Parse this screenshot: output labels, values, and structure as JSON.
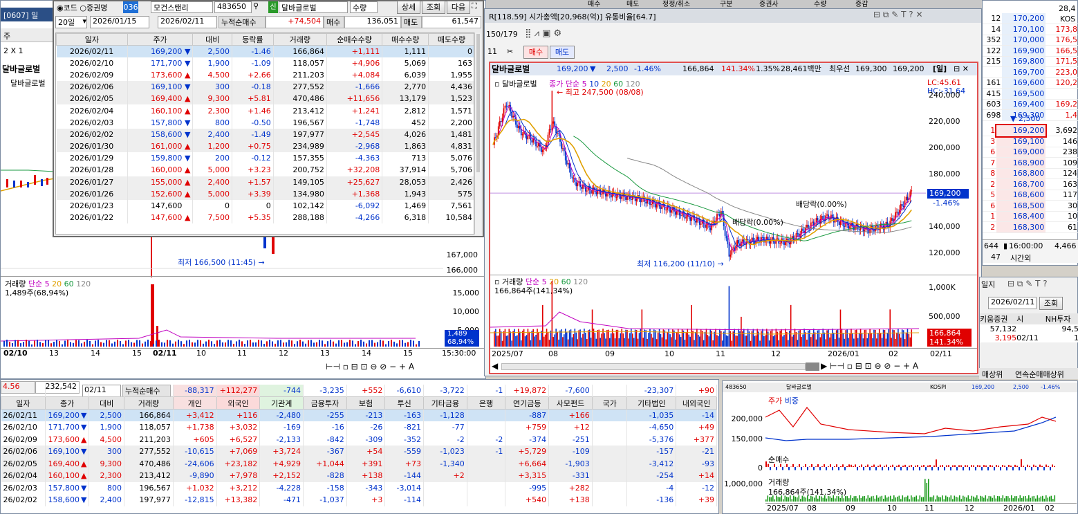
{
  "left_window": {
    "title": "[0607] 일",
    "chart_title": "달바글로벌",
    "chart_sub": "달바글로벌",
    "low_label": "최저 166,500 (11:45)",
    "prices": [
      "167,000",
      "166,000"
    ],
    "vol_legend": {
      "label": "거래량",
      "ma": "단순",
      "p1": "5",
      "p2": "20",
      "p3": "60",
      "p4": "120"
    },
    "vol_value": "1,489주(68,94%)",
    "vol_axis": [
      "15,000",
      "10,000",
      "5,000"
    ],
    "vol_box1": "1,489",
    "vol_box2": "68,94%",
    "x_labels": [
      "02/10",
      "13",
      "14",
      "15",
      "02/11",
      "10",
      "11",
      "12",
      "13",
      "14",
      "15",
      "15:30:00"
    ],
    "stats_label": "4.56",
    "stats_value": "232,542",
    "tool_row": "2 X 1",
    "zoom": "주"
  },
  "daily_popup": {
    "radio1": "코드",
    "radio2": "증권명",
    "broker_code": "036",
    "broker_name": "모건스탠리",
    "stock_code": "483650",
    "stock_badge": "신",
    "stock_name": "달바글로벌",
    "qty_label": "수량",
    "btn_detail": "상세",
    "btn_query": "조회",
    "btn_next": "다음",
    "period": "20일",
    "date_from": "2026/01/15",
    "date_to": "2026/02/11",
    "cum_label": "누적순매수",
    "cum_value": "+74,504",
    "buy_label": "매수",
    "buy_value": "136,051",
    "sell_label": "매도",
    "sell_value": "61,547",
    "columns": [
      "일자",
      "주가",
      "대비",
      "등락률",
      "거래량",
      "순매수수량",
      "매수수량",
      "매도수량"
    ],
    "rows": [
      [
        "2026/02/11",
        "169,200",
        "▼",
        "2,500",
        "-1.46",
        "166,864",
        "+1,111",
        "1,111",
        "0"
      ],
      [
        "2026/02/10",
        "171,700",
        "▼",
        "1,900",
        "-1.09",
        "118,057",
        "+4,906",
        "5,069",
        "163"
      ],
      [
        "2026/02/09",
        "173,600",
        "▲",
        "4,500",
        "+2.66",
        "211,203",
        "+4,084",
        "6,039",
        "1,955"
      ],
      [
        "2026/02/06",
        "169,100",
        "▼",
        "300",
        "-0.18",
        "277,552",
        "-1,666",
        "2,770",
        "4,436"
      ],
      [
        "2026/02/05",
        "169,400",
        "▲",
        "9,300",
        "+5.81",
        "470,486",
        "+11,656",
        "13,179",
        "1,523"
      ],
      [
        "2026/02/04",
        "160,100",
        "▲",
        "2,300",
        "+1.46",
        "213,412",
        "+1,241",
        "2,812",
        "1,571"
      ],
      [
        "2026/02/03",
        "157,800",
        "▼",
        "800",
        "-0.50",
        "196,567",
        "-1,748",
        "452",
        "2,200"
      ],
      [
        "2026/02/02",
        "158,600",
        "▼",
        "2,400",
        "-1.49",
        "197,977",
        "+2,545",
        "4,026",
        "1,481"
      ],
      [
        "2026/01/30",
        "161,000",
        "▲",
        "1,200",
        "+0.75",
        "234,989",
        "-2,968",
        "1,863",
        "4,831"
      ],
      [
        "2026/01/29",
        "159,800",
        "▼",
        "200",
        "-0.12",
        "157,355",
        "-4,363",
        "713",
        "5,076"
      ],
      [
        "2026/01/28",
        "160,000",
        "▲",
        "5,000",
        "+3.23",
        "200,752",
        "+32,208",
        "37,914",
        "5,706"
      ],
      [
        "2026/01/27",
        "155,000",
        "▲",
        "2,400",
        "+1.57",
        "149,105",
        "+25,627",
        "28,053",
        "2,426"
      ],
      [
        "2026/01/26",
        "152,600",
        "▲",
        "5,000",
        "+3.39",
        "134,980",
        "+1,368",
        "1,943",
        "575"
      ],
      [
        "2026/01/23",
        "147,600",
        "",
        "0",
        "0",
        "102,142",
        "-6,092",
        "1,469",
        "7,561"
      ],
      [
        "2026/01/22",
        "147,600",
        "▲",
        "7,500",
        "+5.35",
        "288,188",
        "-4,266",
        "6,318",
        "10,584"
      ]
    ]
  },
  "main_chart": {
    "title_bar": "R[118.59] 시가총액[20,968(억)] 유통비율[64.7]",
    "page": "150/179",
    "buy_btn": "매수",
    "sell_btn": "매도",
    "info": {
      "name": "달바글로벌",
      "price": "169,200",
      "arrow": "▼",
      "change": "2,500",
      "rate": "-1.46%",
      "volume": "166,864",
      "vol_ratio": "141.34%",
      "turnover": "1.35%",
      "amount": "28,461백만",
      "best_ask_label": "최우선",
      "best_ask": "169,300",
      "best_bid": "169,200",
      "period": "일"
    },
    "legend": {
      "name": "달바글로벌",
      "close": "종가",
      "ma": "단순",
      "p1": "5",
      "p2": "10",
      "p3": "20",
      "p4": "60",
      "p5": "120"
    },
    "lc": "LC:45.61",
    "hc": "HC:-31.64",
    "high_label": "최고 247,500 (08/08)",
    "low_label": "최저 116,200 (11/10)",
    "div1": "배당락(0.00%)",
    "div2": "배당락(0.00%)",
    "y_axis": [
      "240,000",
      "220,000",
      "200,000",
      "180,000",
      "160,000",
      "140,000",
      "120,000"
    ],
    "price_box": "169,200",
    "price_rate": "-1.46%",
    "vol_legend": {
      "label": "거래량",
      "ma": "단순",
      "p1": "5",
      "p2": "20",
      "p3": "60",
      "p4": "120"
    },
    "vol_value": "166,864주(141,34%)",
    "vol_axis": [
      "1,000K",
      "500,000"
    ],
    "vol_box1": "166,864",
    "vol_box2": "141.34%",
    "x_labels": [
      "2025/07",
      "08",
      "09",
      "10",
      "11",
      "12",
      "2026/01",
      "02",
      "02/11"
    ]
  },
  "top_right_tabs": [
    "구분",
    "증권사",
    "수량",
    "증감"
  ],
  "top_tabs": [
    "매수",
    "매도",
    "정정/취소"
  ],
  "orderbook": {
    "rows": [
      [
        "12",
        "170,200",
        ""
      ],
      [
        "14",
        "170,100",
        "173,8"
      ],
      [
        "352",
        "170,000",
        "176,5"
      ],
      [
        "122",
        "169,900",
        "166,5"
      ],
      [
        "215",
        "169,800",
        "171,5"
      ],
      [
        "",
        "169,700",
        "223,0"
      ],
      [
        "161",
        "169,600",
        "120,2"
      ],
      [
        "415",
        "169,500",
        ""
      ],
      [
        "603",
        "169,400",
        "169,2"
      ],
      [
        "698",
        "169,300",
        "1,4"
      ]
    ],
    "ask_label": "▼ 2,500",
    "kosdaq": "KOS",
    "bids": [
      [
        "1",
        "169,200",
        "3,692"
      ],
      [
        "3",
        "169,100",
        "146"
      ],
      [
        "6",
        "169,000",
        "238"
      ],
      [
        "7",
        "168,900",
        "109"
      ],
      [
        "8",
        "168,800",
        "124"
      ],
      [
        "2",
        "168,700",
        "163"
      ],
      [
        "5",
        "168,600",
        "117"
      ],
      [
        "6",
        "168,500",
        "30"
      ],
      [
        "1",
        "168,400",
        "10"
      ],
      [
        "2",
        "168,300",
        "61"
      ]
    ],
    "total_left": "644",
    "time": "16:00:00",
    "total_right": "4,466",
    "after": "47",
    "after_label": "시간외",
    "top_value": "28,4"
  },
  "broker_panel": {
    "title": "일지",
    "date": "2026/02/11",
    "btn": "조회",
    "col1": "키움증권",
    "col2": "시",
    "col3": "NH투자",
    "v1": "57,132",
    "v2": "94,5",
    "v3": "3,195",
    "v4": "02/11",
    "v5": "1"
  },
  "right_tabs": [
    "매상위",
    "연속순매매상위"
  ],
  "investor": {
    "date": "02/11",
    "cum_label": "누적순매수",
    "header_left": "4.56",
    "header_val": "232,542",
    "cum_values": [
      "-88,317",
      "+112,277",
      "-744",
      "-3,235",
      "+552",
      "-6,610",
      "-3,722",
      "-1",
      "+19,872",
      "-7,600",
      "",
      "-23,307",
      "+90"
    ],
    "columns": [
      "일자",
      "종가",
      "대비",
      "거래량",
      "개인",
      "외국인",
      "기관계",
      "금융투자",
      "보험",
      "투신",
      "기타금융",
      "은행",
      "연기금등",
      "사모펀드",
      "국가",
      "기타법인",
      "내외국인"
    ],
    "rows": [
      [
        "26/02/11",
        "169,200",
        "▼",
        "2,500",
        "166,864",
        "+3,412",
        "+116",
        "-2,480",
        "-255",
        "-213",
        "-163",
        "-1,128",
        "",
        "-887",
        "+166",
        "",
        "-1,035",
        "-14"
      ],
      [
        "26/02/10",
        "171,700",
        "▼",
        "1,900",
        "118,057",
        "+1,738",
        "+3,032",
        "-169",
        "-16",
        "-26",
        "-821",
        "-77",
        "",
        "+759",
        "+12",
        "",
        "-4,650",
        "+49"
      ],
      [
        "26/02/09",
        "173,600",
        "▲",
        "4,500",
        "211,203",
        "+605",
        "+6,527",
        "-2,133",
        "-842",
        "-309",
        "-352",
        "-2",
        "-2",
        "-374",
        "-251",
        "",
        "-5,376",
        "+377"
      ],
      [
        "26/02/06",
        "169,100",
        "▼",
        "300",
        "277,552",
        "-10,615",
        "+7,069",
        "+3,724",
        "-367",
        "+54",
        "-559",
        "-1,023",
        "-1",
        "+5,729",
        "-109",
        "",
        "-157",
        "-21"
      ],
      [
        "26/02/05",
        "169,400",
        "▲",
        "9,300",
        "470,486",
        "-24,606",
        "+23,182",
        "+4,929",
        "+1,044",
        "+391",
        "+73",
        "-1,340",
        "",
        "+6,664",
        "-1,903",
        "",
        "-3,412",
        "-93"
      ],
      [
        "26/02/04",
        "160,100",
        "▲",
        "2,300",
        "213,412",
        "-9,890",
        "+7,978",
        "+2,152",
        "-828",
        "+138",
        "-144",
        "+2",
        "",
        "+3,315",
        "-331",
        "",
        "-254",
        "+14"
      ],
      [
        "26/02/03",
        "157,800",
        "▼",
        "800",
        "196,567",
        "+1,032",
        "+3,212",
        "-4,228",
        "-158",
        "-343",
        "-3,014",
        "",
        "",
        "-995",
        "+282",
        "",
        "-4",
        "-12"
      ],
      [
        "26/02/02",
        "158,600",
        "▼",
        "2,400",
        "197,977",
        "-12,815",
        "+13,382",
        "-471",
        "-1,037",
        "+3",
        "-114",
        "",
        "",
        "+540",
        "+138",
        "",
        "-136",
        "+39"
      ]
    ]
  },
  "mini_chart": {
    "code": "483650",
    "name": "달바글로벌",
    "market": "KOSPI",
    "price": "169,200",
    "change": "2,500",
    "rate": "-1.46%",
    "legend1": "주가",
    "legend2": "비중",
    "y1": [
      "200,000",
      "150,000"
    ],
    "legend3": "순매수",
    "zero": "0",
    "legend4": "거래량",
    "y4": "1,000,000",
    "vol_value": "166,864주(141.34%)",
    "x_labels": [
      "2025/07",
      "08",
      "09",
      "10",
      "11",
      "12",
      "2026/01",
      "02"
    ]
  }
}
